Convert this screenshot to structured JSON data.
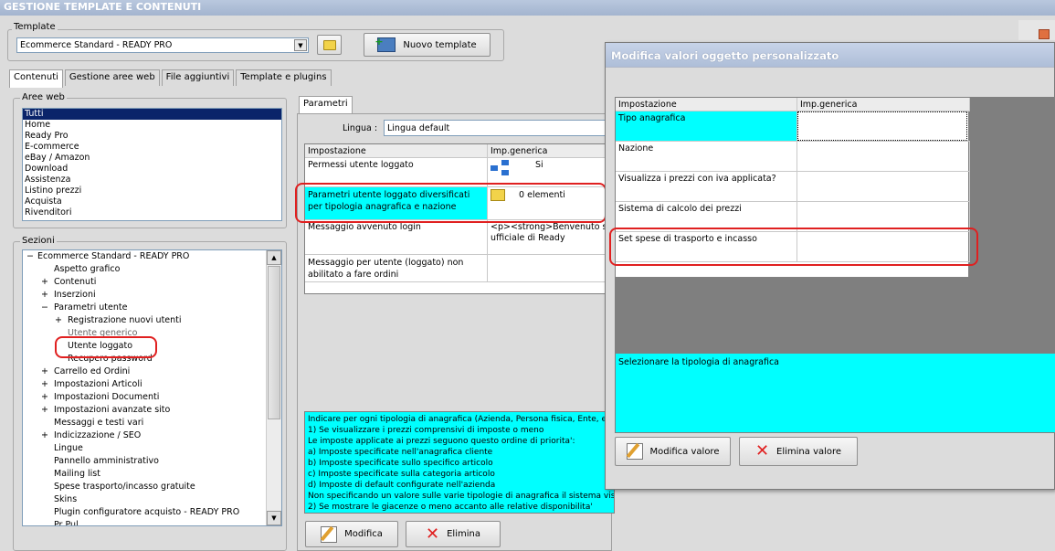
{
  "app": {
    "title": "GESTIONE TEMPLATE E CONTENUTI"
  },
  "template": {
    "group_label": "Template",
    "selected": "Ecommerce Standard - READY PRO",
    "new_button": "Nuovo template"
  },
  "tabs": [
    "Contenuti",
    "Gestione aree web",
    "File aggiuntivi",
    "Template e plugins"
  ],
  "aree_web": {
    "label": "Aree web",
    "items": [
      "Tutti",
      "Home",
      "Ready Pro",
      "E-commerce",
      "eBay / Amazon",
      "Download",
      "Assistenza",
      "Listino prezzi",
      "Acquista",
      "Rivenditori"
    ]
  },
  "sezioni": {
    "label": "Sezioni",
    "items": [
      {
        "text": "Ecommerce Standard - READY PRO",
        "prefix": "−"
      },
      {
        "text": "Aspetto grafico",
        "prefix": ""
      },
      {
        "text": "Contenuti",
        "prefix": "+"
      },
      {
        "text": "Inserzioni",
        "prefix": "+"
      },
      {
        "text": "Parametri utente",
        "prefix": "−"
      },
      {
        "text": "Registrazione nuovi utenti",
        "prefix": "+"
      },
      {
        "text": "Utente generico",
        "prefix": ""
      },
      {
        "text": "Utente loggato",
        "prefix": ""
      },
      {
        "text": "Recupero password",
        "prefix": ""
      },
      {
        "text": "Carrello ed Ordini",
        "prefix": "+"
      },
      {
        "text": "Impostazioni Articoli",
        "prefix": "+"
      },
      {
        "text": "Impostazioni Documenti",
        "prefix": "+"
      },
      {
        "text": "Impostazioni avanzate sito",
        "prefix": "+"
      },
      {
        "text": "Messaggi e testi vari",
        "prefix": ""
      },
      {
        "text": "Indicizzazione / SEO",
        "prefix": "+"
      },
      {
        "text": "Lingue",
        "prefix": ""
      },
      {
        "text": "Pannello amministrativo",
        "prefix": ""
      },
      {
        "text": "Mailing list",
        "prefix": ""
      },
      {
        "text": "Spese trasporto/incasso gratuite",
        "prefix": ""
      },
      {
        "text": "Skins",
        "prefix": ""
      },
      {
        "text": "Plugin configuratore acquisto - READY PRO",
        "prefix": ""
      },
      {
        "text": "Pr Pul...",
        "prefix": ""
      }
    ]
  },
  "parametri": {
    "tab": "Parametri",
    "lingua_label": "Lingua :",
    "lingua_value": "Lingua default",
    "headers": [
      "Impostazione",
      "Imp.generica"
    ],
    "rows": [
      {
        "name": "Permessi utente loggato",
        "value": "Si"
      },
      {
        "name": "Parametri utente loggato diversificati per tipologia anagrafica e nazione",
        "value": "0 elementi"
      },
      {
        "name": "Messaggio avvenuto login",
        "value": "<p><strong>Benvenuto s ufficiale di Ready"
      },
      {
        "name": "Messaggio per utente (loggato) non abilitato a fare ordini",
        "value": ""
      }
    ],
    "help": "Indicare per ogni tipologia di anagrafica (Azienda, Persona fisica, Ente, ec\n1) Se visualizzare i prezzi comprensivi di imposte o meno\nLe imposte applicate ai prezzi seguono questo ordine di priorita':\na) Imposte specificate nell'anagrafica cliente\nb) Imposte specificate sullo specifico articolo\nc) Imposte specificate sulla categoria articolo\nd) Imposte di default configurate nell'azienda\nNon specificando un valore sulle varie tipologie di anagrafica il sistema visualiz\n2) Se mostrare le giacenze o meno accanto alle relative disponibilita'",
    "modifica": "Modifica",
    "elimina": "Elimina"
  },
  "dialog": {
    "title": "Modifica valori oggetto personalizzato",
    "headers": [
      "Impostazione",
      "Imp.generica"
    ],
    "rows": [
      "Tipo anagrafica",
      "Nazione",
      "Visualizza i prezzi con iva applicata?",
      "Sistema di calcolo dei prezzi",
      "Set spese di trasporto e incasso"
    ],
    "description": "Selezionare la tipologia di anagrafica",
    "modifica": "Modifica valore",
    "elimina": "Elimina valore"
  },
  "colors": {
    "highlight": "#00ffff",
    "selection": "#0a246a",
    "annotation": "#e02020"
  }
}
